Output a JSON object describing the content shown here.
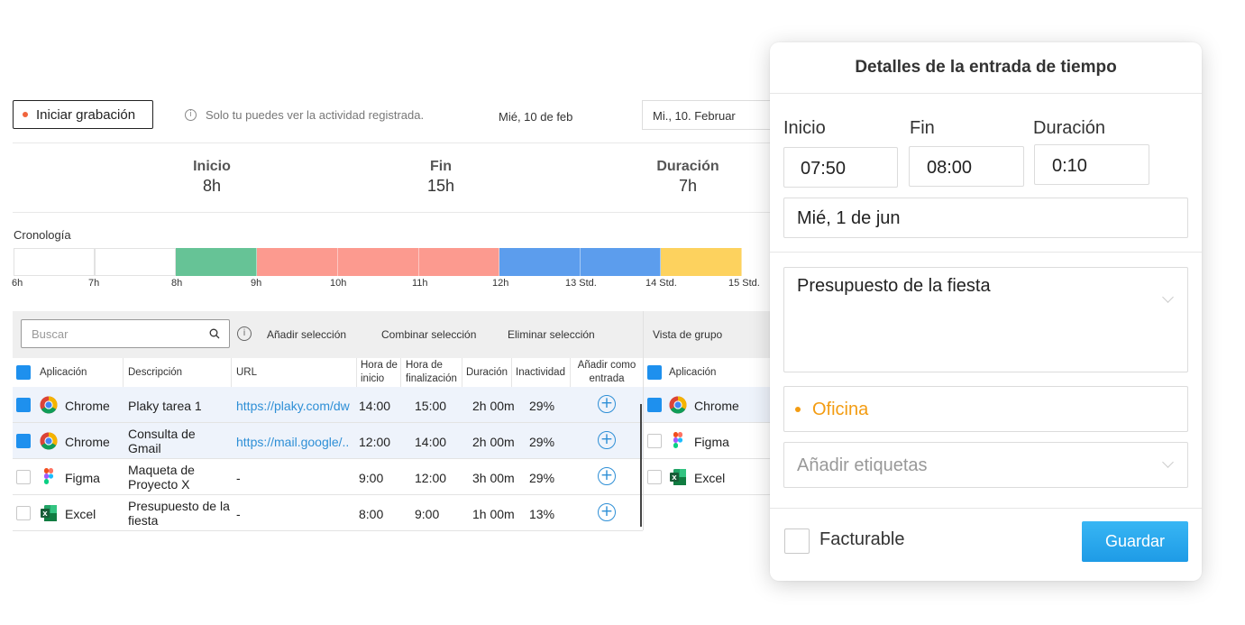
{
  "top_bar": {
    "record_label": "Iniciar grabación",
    "info_text": "Solo tu puedes ver la actividad registrada.",
    "date_text": "Mié, 10 de feb",
    "date_box": "Mi., 10. Februar"
  },
  "summary": {
    "start": {
      "label": "Inicio",
      "value": "8h"
    },
    "end": {
      "label": "Fin",
      "value": "15h"
    },
    "duration": {
      "label": "Duración",
      "value": "7h"
    }
  },
  "timeline": {
    "label": "Cronología",
    "ticks": [
      "6h",
      "7h",
      "8h",
      "9h",
      "10h",
      "11h",
      "12h",
      "13 Std.",
      "14 Std.",
      "15 Std."
    ],
    "colors": {
      "green": "#66c396",
      "salmon": "#fc9a8f",
      "blue": "#5c9ded",
      "yellow": "#fdd25e"
    }
  },
  "table": {
    "search_placeholder": "Buscar",
    "actions": [
      "Añadir selección",
      "Combinar selección",
      "Eliminar selección"
    ],
    "columns": {
      "app": "Aplicación",
      "desc": "Descripción",
      "url": "URL",
      "start": [
        "Hora de",
        "inicio"
      ],
      "end": [
        "Hora de",
        "finalización"
      ],
      "duration": "Duración",
      "inactivity": "Inactividad",
      "add_entry": [
        "Añadir como",
        "entrada"
      ]
    },
    "rows": [
      {
        "app": "Chrome",
        "desc": [
          "Plaky tarea 1"
        ],
        "url": "https://plaky.com/dw",
        "start": "14:00",
        "end": "15:00",
        "duration": "2h 00m",
        "inactivity": "29%"
      },
      {
        "app": "Chrome",
        "desc": [
          "Consulta de",
          "Gmail"
        ],
        "url": "https://mail.google/..",
        "start": "12:00",
        "end": "14:00",
        "duration": "2h 00m",
        "inactivity": "29%"
      },
      {
        "app": "Figma",
        "desc": [
          "Maqueta de",
          "Proyecto X"
        ],
        "url": "-",
        "start": "9:00",
        "end": "12:00",
        "duration": "3h 00m",
        "inactivity": "29%"
      },
      {
        "app": "Excel",
        "desc": [
          "Presupuesto de la",
          "fiesta"
        ],
        "url": "-",
        "start": "8:00",
        "end": "9:00",
        "duration": "1h 00m",
        "inactivity": "13%"
      }
    ]
  },
  "group_view": {
    "title": "Vista de grupo",
    "column": "Aplicación",
    "rows": [
      "Chrome",
      "Figma",
      "Excel"
    ]
  },
  "modal": {
    "title": "Detalles de la entrada de tiempo",
    "start_label": "Inicio",
    "end_label": "Fin",
    "duration_label": "Duración",
    "start_value": "07:50",
    "end_value": "08:00",
    "duration_value": "0:10",
    "date_value": "Mié, 1 de jun",
    "description": "Presupuesto de la fiesta",
    "project": "Oficina",
    "project_color": "#f39c12",
    "tags_placeholder": "Añadir etiquetas",
    "billable_label": "Facturable",
    "save_label": "Guardar"
  }
}
